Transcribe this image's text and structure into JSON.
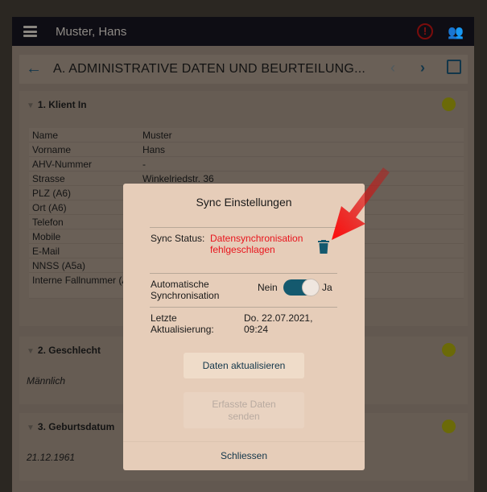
{
  "header": {
    "title": "Muster, Hans",
    "menu_icon": "hamburger-icon",
    "sync_icon": "sync-error-icon",
    "users_icon": "users-icon"
  },
  "titlebar": {
    "title": "A. ADMINISTRATIVE DATEN UND BEURTEILUNG..."
  },
  "sections": [
    {
      "title": "1. Klient In",
      "status_color": "#6b6a08",
      "fields": [
        {
          "label": "Name",
          "value": "Muster"
        },
        {
          "label": "Vorname",
          "value": "Hans"
        },
        {
          "label": "AHV-Nummer",
          "value": "-"
        },
        {
          "label": "Strasse",
          "value": "Winkelriedstr. 36"
        },
        {
          "label": "PLZ (A6)",
          "value": ""
        },
        {
          "label": "Ort (A6)",
          "value": ""
        },
        {
          "label": "Telefon",
          "value": ""
        },
        {
          "label": "Mobile",
          "value": ""
        },
        {
          "label": "E-Mail",
          "value": ""
        },
        {
          "label": "NNSS (A5a)",
          "value": ""
        },
        {
          "label": "Interne Fallnummer (A5b)",
          "value": ""
        }
      ]
    },
    {
      "title": "2. Geschlecht",
      "value": "Männlich"
    },
    {
      "title": "3. Geburtsdatum",
      "value": "21.12.1961"
    }
  ],
  "modal": {
    "title": "Sync Einstellungen",
    "sync_status_label": "Sync Status:",
    "sync_status_line1": "Datensynchronisation",
    "sync_status_line2": "fehlgeschlagen",
    "delete_icon": "trash-icon",
    "auto_label_1": "Automatische",
    "auto_label_2": "Synchronisation",
    "toggle_off": "Nein",
    "toggle_on": "Ja",
    "auto_sync_enabled": true,
    "last_label_1": "Letzte",
    "last_label_2": "Aktualisierung:",
    "last_value_1": "Do. 22.07.2021,",
    "last_value_2": "09:24",
    "refresh_button": "Daten aktualisieren",
    "send_button_1": "Erfasste Daten",
    "send_button_2": "senden",
    "close_button": "Schliessen",
    "error_color": "#e8141c",
    "accent": "#14596e"
  }
}
